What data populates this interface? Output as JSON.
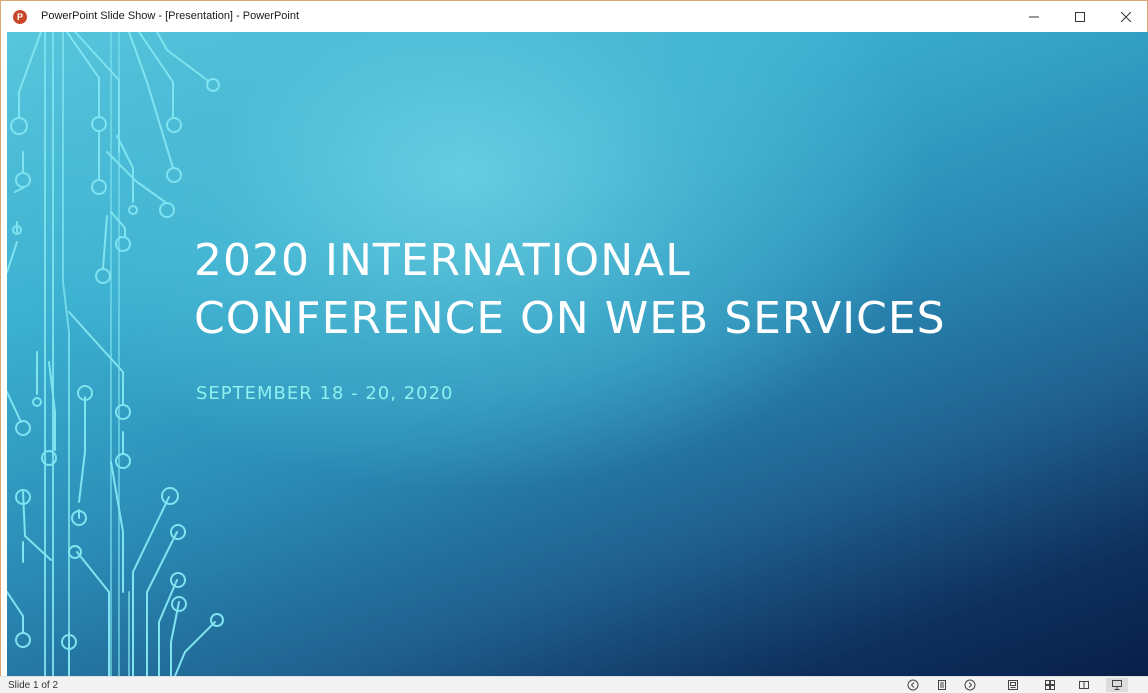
{
  "window": {
    "app_icon_letter": "P",
    "title": "PowerPoint Slide Show - [Presentation] - PowerPoint",
    "icons": [
      "powerpoint-icon",
      "minimize-icon",
      "maximize-icon",
      "close-icon"
    ]
  },
  "slide": {
    "title_line1": "2020 INTERNATIONAL",
    "title_line2": "CONFERENCE ON WEB SERVICES",
    "subtitle": "SEPTEMBER 18 - 20, 2020",
    "colors": {
      "title": "#ffffff",
      "subtitle": "#8ff0ef",
      "circuit": "#7fe3f0",
      "background_light": "#58c6dc",
      "background_dark": "#08204a"
    }
  },
  "statusbar": {
    "slide_count": "Slide 1 of 2",
    "icons": [
      "previous-slide-icon",
      "slide-menu-icon",
      "next-slide-icon",
      "normal-view-icon",
      "slide-sorter-icon",
      "reading-view-icon",
      "slide-show-icon"
    ]
  }
}
